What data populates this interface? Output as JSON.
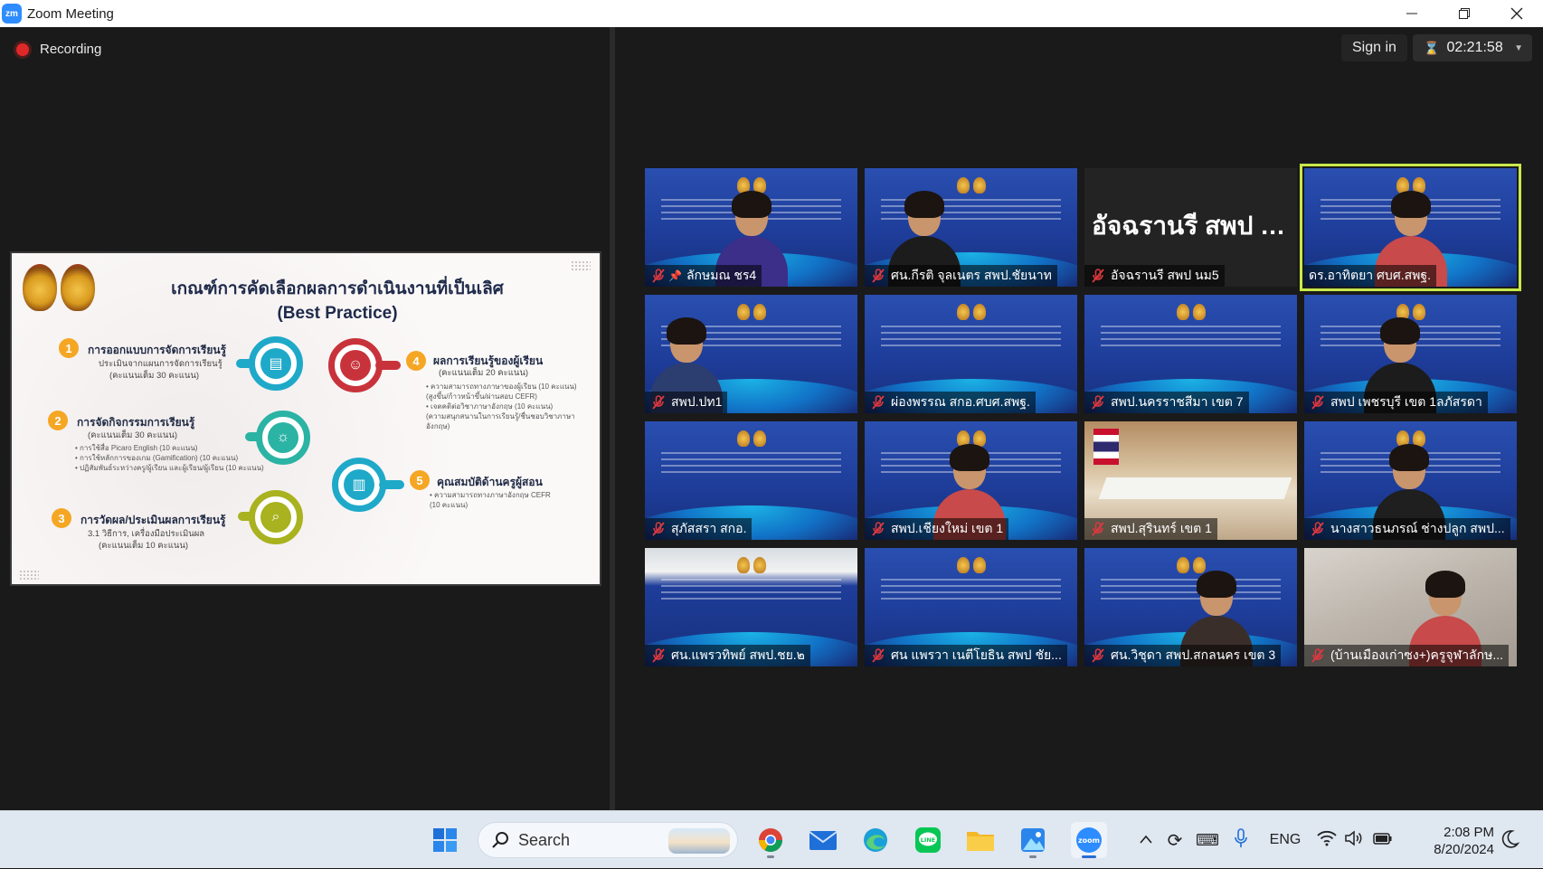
{
  "window": {
    "title": "Zoom Meeting",
    "app_icon_text": "zm"
  },
  "meeting": {
    "recording_label": "Recording",
    "sign_in_label": "Sign in",
    "timer": "02:21:58"
  },
  "slide": {
    "title_line1": "เกณฑ์การคัดเลือกผลการดำเนินงานที่เป็นเลิศ",
    "title_line2": "(Best Practice)",
    "items": [
      {
        "num": "1",
        "title": "การออกแบบการจัดการเรียนรู้",
        "text1": "ประเมินจากแผนการจัดการเรียนรู้",
        "text2": "(คะแนนเต็ม 30 คะแนน)"
      },
      {
        "num": "2",
        "title": "การจัดกิจกรรมการเรียนรู้",
        "text1": "(คะแนนเต็ม 30 คะแนน)",
        "bullets": [
          "• การใช้สื่อ Picaro English (10 คะแนน)",
          "• การใช้หลักการของเกม (Gamification) (10 คะแนน)",
          "• ปฏิสัมพันธ์ระหว่างครู/ผู้เรียน และผู้เรียน/ผู้เรียน (10 คะแนน)"
        ]
      },
      {
        "num": "3",
        "title": "การวัดผล/ประเมินผลการเรียนรู้",
        "text1": "3.1 วิธีการ, เครื่องมือประเมินผล",
        "text2": "(คะแนนเต็ม 10 คะแนน)"
      },
      {
        "num": "4",
        "title": "ผลการเรียนรู้ของผู้เรียน",
        "text1": "(คะแนนเต็ม 20 คะแนน)",
        "bullets": [
          "• ความสามารถทางภาษาของผู้เรียน (10 คะแนน)",
          "(สูงขึ้น/ก้าวหน้าขึ้น/ผ่านสอบ CEFR)",
          "• เจตคติต่อวิชาภาษาอังกฤษ (10 คะแนน)",
          "(ความสนุกสนานในการเรียนรู้/ชื่นชอบวิชาภาษา",
          "อังกฤษ)"
        ]
      },
      {
        "num": "5",
        "title": "คุณสมบัติด้านครูผู้สอน",
        "bullets": [
          "• ความสามารถทางภาษาอังกฤษ CEFR",
          "(10 คะแนน)"
        ]
      }
    ]
  },
  "gallery": {
    "participants": [
      {
        "name": "ลักษมณ ชร4",
        "pinned": true,
        "muted": true,
        "kind": "video"
      },
      {
        "name": "ศน.กีรติ จุลเนตร สพป.ชัยนาท",
        "muted": true,
        "kind": "video"
      },
      {
        "name": "อัจฉรานรี สพป นม5",
        "display_name": "อัจฉรานรี สพป น...",
        "muted": true,
        "kind": "name-only"
      },
      {
        "name": "ดร.อาทิตยา ศบศ.สพฐ.",
        "muted": false,
        "kind": "video",
        "active_speaker": true
      },
      {
        "name": "สพป.ปท1",
        "muted": true,
        "kind": "video"
      },
      {
        "name": "ผ่องพรรณ สกอ.ศบศ.สพฐ.",
        "muted": true,
        "kind": "video"
      },
      {
        "name": "สพป.นครราชสีมา เขต 7",
        "muted": true,
        "kind": "video"
      },
      {
        "name": "สพป เพชรบุรี เขต 1ลภัสรดา",
        "muted": true,
        "kind": "video"
      },
      {
        "name": "สุภัสสรา สกอ.",
        "muted": true,
        "kind": "video"
      },
      {
        "name": "สพป.เชียงใหม่ เขต 1",
        "muted": true,
        "kind": "video"
      },
      {
        "name": "สพป.สุรินทร์ เขต 1",
        "muted": true,
        "kind": "room"
      },
      {
        "name": "นางสาวธนภรณ์ ช่างปลูก สพป...",
        "muted": true,
        "kind": "video"
      },
      {
        "name": "ศน.แพรวทิพย์ สพป.ชย.๒",
        "muted": true,
        "kind": "lobby"
      },
      {
        "name": "ศน แพรวา เนตีโยธิน สพป ชัย...",
        "muted": true,
        "kind": "video"
      },
      {
        "name": "ศน.วิชุดา สพป.สกลนคร เขต 3",
        "muted": true,
        "kind": "video"
      },
      {
        "name": "(บ้านเมืองเก่าซง+)ครูจุฬาลักษ...",
        "muted": true,
        "kind": "blurcam"
      }
    ]
  },
  "taskbar": {
    "search_label": "Search",
    "language": "ENG",
    "time": "2:08 PM",
    "date": "8/20/2024",
    "apps": [
      "start-icon",
      "chrome-icon",
      "mail-icon",
      "edge-icon",
      "line-icon",
      "file-explorer-icon",
      "photos-icon",
      "zoom-icon"
    ]
  },
  "colors": {
    "accent": "#2d8cff",
    "active_speaker_border": "#c8e84a",
    "record_red": "#e02828",
    "mic_muted": "#e0383e"
  }
}
